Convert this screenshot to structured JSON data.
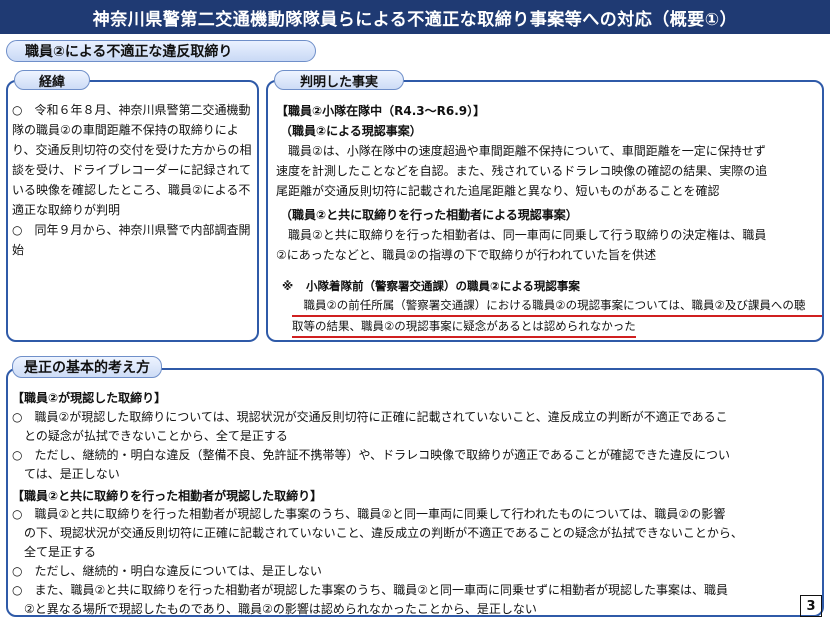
{
  "title": "神奈川県警第二交通機動隊隊員らによる不適正な取締り事案等への対応（概要①）",
  "subtitle": "職員②による不適正な違反取締り",
  "left_panel": {
    "tab": "経緯",
    "items": [
      "○　令和６年８月、神奈川県警第二交通機動隊の職員②の車間距離不保持の取締りにより、交通反則切符の交付を受けた方からの相談を受け、ドライブレコーダーに記録されている映像を確認したところ、職員②による不適正な取締りが判明",
      "○　同年９月から、神奈川県警で内部調査開始"
    ]
  },
  "right_panel": {
    "tab": "判明した事実",
    "period": "【職員②小隊在隊中（R4.3～R6.9）】",
    "sec1_title": "（職員②による現認事案）",
    "sec1_lines": [
      "職員②は、小隊在隊中の速度超過や車間距離不保持について、車間距離を一定に保持せず",
      "速度を計測したことなどを自認。また、残されているドラレコ映像の確認の結果、実際の追",
      "尾距離が交通反則切符に記載された追尾距離と異なり、短いものがあることを確認"
    ],
    "sec2_title": "（職員②と共に取締りを行った相勤者による現認事案）",
    "sec2_lines": [
      "職員②と共に取締りを行った相勤者は、同一車両に同乗して行う取締りの決定権は、職員",
      "②にあったなどと、職員②の指導の下で取締りが行われていた旨を供述"
    ],
    "note_mark": "※",
    "note_title": "小隊着隊前（警察署交通課）の職員②による現認事案",
    "note_lines": [
      "職員②の前任所属（警察署交通課）における職員②の現認事案については、職員②及び課員への聴",
      "取等の結果、職員②の現認事案に疑念があるとは認められなかった"
    ]
  },
  "bottom_panel": {
    "tab": "是正の基本的考え方",
    "sec1_title": "【職員②が現認した取締り】",
    "sec1_lines": [
      "○　職員②が現認した取締りについては、現認状況が交通反則切符に正確に記載されていないこと、違反成立の判断が不適正であるこ",
      "との疑念が払拭できないことから、全て是正する",
      "○　ただし、継続的・明白な違反（整備不良、免許証不携帯等）や、ドラレコ映像で取締りが適正であることが確認できた違反につい",
      "ては、是正しない"
    ],
    "sec2_title": "【職員②と共に取締りを行った相勤者が現認した取締り】",
    "sec2_lines": [
      "○　職員②と共に取締りを行った相勤者が現認した事案のうち、職員②と同一車両に同乗して行われたものについては、職員②の影響",
      "の下、現認状況が交通反則切符に正確に記載されていないこと、違反成立の判断が不適正であることの疑念が払拭できないことから、",
      "全て是正する",
      "○　ただし、継続的・明白な違反については、是正しない",
      "○　また、職員②と共に取締りを行った相勤者が現認した事案のうち、職員②と同一車両に同乗せずに相勤者が現認した事案は、職員",
      "②と異なる場所で現認したものであり、職員②の影響は認められなかったことから、是正しない"
    ]
  },
  "page_number": "3"
}
